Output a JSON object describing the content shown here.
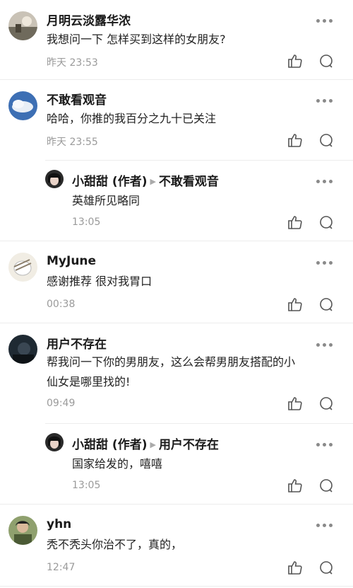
{
  "comments": [
    {
      "name": "月明云淡露华浓",
      "text": "我想问一下 怎样买到这样的女朋友?",
      "time": "昨天 23:53"
    },
    {
      "name": "不敢看观音",
      "text": "哈哈，你推的我百分之九十已关注",
      "time": "昨天 23:55",
      "reply": {
        "author": "小甜甜 (作者)",
        "target": "不敢看观音",
        "text": "英雄所见略同",
        "time": "13:05"
      }
    },
    {
      "name": "MyJune",
      "text": "感谢推荐 很对我胃口",
      "time": "00:38"
    },
    {
      "name": "用户不存在",
      "text_lines": [
        "帮我问一下你的男朋友，这么会帮男朋友搭配的小",
        "仙女是哪里找的!"
      ],
      "time": "09:49",
      "reply": {
        "author": "小甜甜 (作者)",
        "target": "用户不存在",
        "text": "国家给发的，嘻嘻",
        "time": "13:05"
      }
    },
    {
      "name": "yhn",
      "text": "秃不秃头你治不了，真的，",
      "time": "12:47"
    }
  ],
  "icons": {
    "more": "more-dots-icon",
    "like": "thumbs-up-icon",
    "reply": "comment-bubble-icon"
  }
}
